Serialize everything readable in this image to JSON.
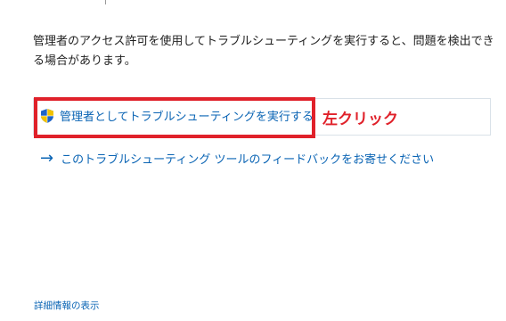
{
  "description": "管理者のアクセス許可を使用してトラブルシューティングを実行すると、問題を検出できる場合があります。",
  "run_as_admin": {
    "label": "管理者としてトラブルシューティングを実行する",
    "icon": "uac-shield-icon"
  },
  "annotation": "左クリック",
  "feedback": {
    "label": "このトラブルシューティング ツールのフィードバックをお寄せください",
    "icon": "arrow-right-icon"
  },
  "details_link": "詳細情報の表示",
  "colors": {
    "link": "#0a64b4",
    "highlight": "#e0212a",
    "text": "#1f1f1f"
  }
}
